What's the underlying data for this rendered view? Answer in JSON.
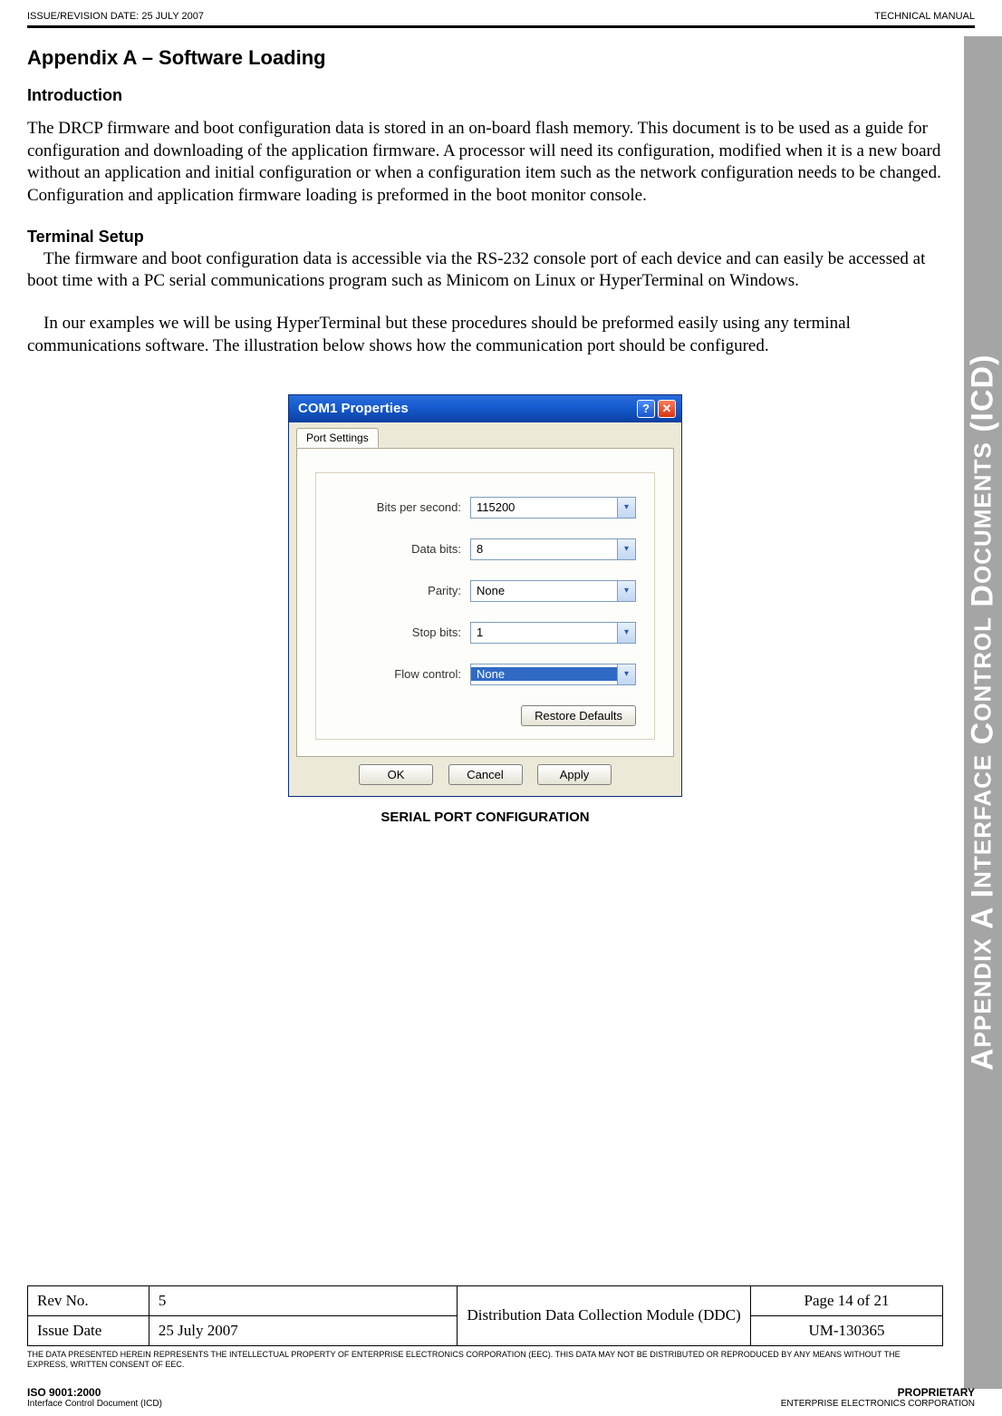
{
  "header": {
    "left": "ISSUE/REVISION DATE:  25 JULY 2007",
    "right": "TECHNICAL MANUAL"
  },
  "sideTab": {
    "part1": "A",
    "part2": "PPENDIX",
    "part3": " A  I",
    "part4": "NTERFACE",
    "part5": " C",
    "part6": "ONTROL",
    "part7": " D",
    "part8": "OCUMENTS",
    "part9": " (ICD)"
  },
  "content": {
    "appendixTitle": "Appendix A – Software Loading",
    "intro": {
      "heading": "Introduction",
      "p1": "The DRCP firmware and boot configuration data is stored in an on-board flash memory. This document is to be used as a guide for configuration and downloading of the application firmware. A processor will need its configuration, modified when it is a new board without an application and initial configuration or when a configuration item such as the network configuration needs to be changed. Configuration and application firmware loading is preformed in the boot monitor console."
    },
    "terminal": {
      "heading": "Terminal Setup",
      "p1": "The firmware and boot configuration data is accessible via the RS-232 console port of each device and can easily be accessed at boot time with a PC serial communications program such as Minicom on Linux or HyperTerminal on Windows.",
      "p2": "In our examples we will be using HyperTerminal but these procedures should be preformed easily using any terminal communications software. The illustration below shows how the communication port should be configured."
    },
    "figCaption": "SERIAL PORT CONFIGURATION"
  },
  "dialog": {
    "title": "COM1 Properties",
    "tab": "Port Settings",
    "fields": {
      "bps": {
        "label": "Bits per second:",
        "value": "115200"
      },
      "databits": {
        "label": "Data bits:",
        "value": "8"
      },
      "parity": {
        "label": "Parity:",
        "value": "None"
      },
      "stopbits": {
        "label": "Stop bits:",
        "value": "1"
      },
      "flow": {
        "label": "Flow control:",
        "value": "None"
      }
    },
    "restore": "Restore Defaults",
    "ok": "OK",
    "cancel": "Cancel",
    "apply": "Apply"
  },
  "table": {
    "revLabel": "Rev No.",
    "revValue": "5",
    "docTitle": "Distribution Data Collection Module (DDC)",
    "pageInfo": "Page 14 of 21",
    "issueLabel": "Issue Date",
    "issueValue": "25 July 2007",
    "docNum": "UM-130365"
  },
  "disclaimer": "THE DATA PRESENTED HEREIN REPRESENTS THE INTELLECTUAL PROPERTY OF ENTERPRISE ELECTRONICS CORPORATION (EEC).  THIS DATA MAY NOT BE DISTRIBUTED OR REPRODUCED BY ANY MEANS WITHOUT THE EXPRESS, WRITTEN CONSENT OF EEC.",
  "bottom": {
    "leftTitle": "ISO 9001:2000",
    "leftSub": "Interface Control Document (ICD)",
    "rightTitle": "PROPRIETARY",
    "rightSub": "ENTERPRISE ELECTRONICS CORPORATION"
  }
}
